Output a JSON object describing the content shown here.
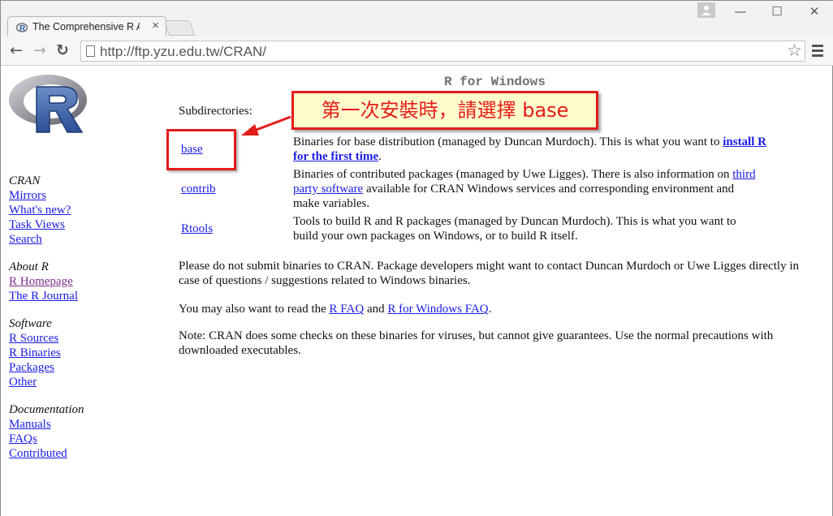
{
  "browser": {
    "tab_title": "The Comprehensive R Ar",
    "tab_close": "×",
    "window_controls": {
      "minimize": "—",
      "maximize": "☐",
      "close": "✕"
    },
    "nav": {
      "back": "←",
      "forward": "→",
      "reload": "↻"
    },
    "url": "http://ftp.yzu.edu.tw/CRAN/",
    "bookmark_star": "☆"
  },
  "page": {
    "title": "R for Windows",
    "subdirectories_label": "Subdirectories:",
    "sidebar": {
      "groups": [
        {
          "heading": "CRAN",
          "links": [
            "Mirrors",
            "What's new?",
            "Task Views",
            "Search"
          ]
        },
        {
          "heading": "About R",
          "links": [
            "R Homepage",
            "The R Journal"
          ]
        },
        {
          "heading": "Software",
          "links": [
            "R Sources",
            "R Binaries",
            "Packages",
            "Other"
          ]
        },
        {
          "heading": "Documentation",
          "links": [
            "Manuals",
            "FAQs",
            "Contributed"
          ]
        }
      ]
    },
    "dirs": [
      {
        "link": "base",
        "desc_before": "Binaries for base distribution (managed by Duncan Murdoch). This is what you want to ",
        "desc_link": "install R for the first time",
        "desc_after": "."
      },
      {
        "link": "contrib",
        "desc_before": "Binaries of contributed packages (managed by Uwe Ligges). There is also information on ",
        "desc_link": "third party software",
        "desc_after": " available for CRAN Windows services and corresponding environment and make variables."
      },
      {
        "link": "Rtools",
        "desc_before": "Tools to build R and R packages (managed by Duncan Murdoch). This is what you want to build your own packages on Windows, or to build R itself."
      }
    ],
    "para_submit": "Please do not submit binaries to CRAN. Package developers might want to contact Duncan Murdoch or Uwe Ligges directly in case of questions / suggestions related to Windows binaries.",
    "para_faq": {
      "before": "You may also want to read the ",
      "link1": "R FAQ",
      "middle": " and ",
      "link2": "R for Windows FAQ",
      "after": "."
    },
    "para_note": "Note: CRAN does some checks on these binaries for viruses, but cannot give guarantees. Use the normal precautions with downloaded executables."
  },
  "annotation": {
    "callout_text": "第一次安裝時，請選擇 base",
    "color": "#e31b1b"
  }
}
